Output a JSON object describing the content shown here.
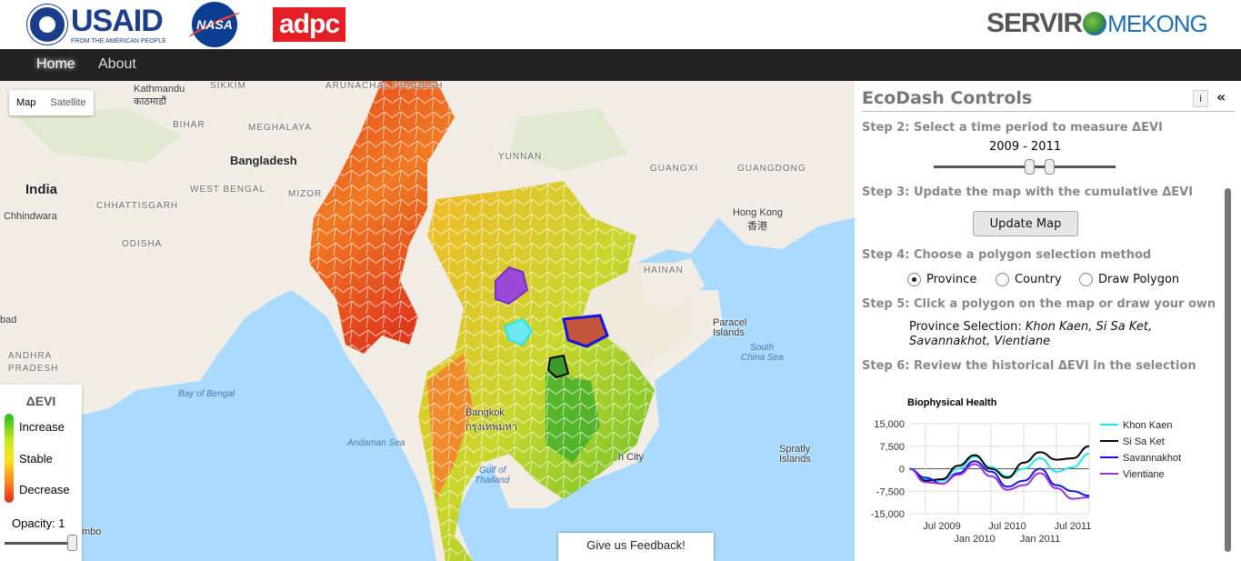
{
  "logos": {
    "usaid": {
      "word": "USAID",
      "sub": "FROM THE AMERICAN PEOPLE"
    },
    "nasa": "NASA",
    "adpc": "adpc",
    "servir_a": "SERVIR",
    "servir_b": "MEKONG"
  },
  "nav": {
    "home": "Home",
    "about": "About"
  },
  "map": {
    "type_buttons": [
      "Map",
      "Satellite"
    ],
    "labels": {
      "kathmandu": "Kathmandu",
      "kathmandu_local": "काठमाडौं",
      "sikkim": "SIKKIM",
      "arunachal": "ARUNACHAL PRADESH",
      "bihar": "BIHAR",
      "meghalaya": "MEGHALAYA",
      "bangladesh": "Bangladesh",
      "india": "India",
      "chhindwara": "Chhindwara",
      "west_bengal": "WEST BENGAL",
      "mizoram": "MIZOR",
      "chhattisgarh": "CHHATTISGARH",
      "odisha": "ODISHA",
      "andhra1": "ANDHRA",
      "andhra2": "PRADESH",
      "bad": "bad",
      "yunnan": "YUNNAN",
      "guangxi": "GUANGXI",
      "guangdong": "GUANGDONG",
      "hongkong": "Hong Kong",
      "hongkong_local": "香港",
      "hainan": "HAINAN",
      "paracel1": "Paracel",
      "paracel2": "Islands",
      "south_china1": "South",
      "south_china2": "China Sea",
      "bay_bengal": "Bay of Bengal",
      "andaman": "Andaman Sea",
      "gulf1": "Gulf of",
      "gulf2": "Thailand",
      "bangkok": "Bangkok",
      "bangkok_local": "กรุงเทพมหา",
      "city": "h City",
      "spratly1": "Spratly",
      "spratly2": "Islands",
      "mbo": "mbo"
    }
  },
  "legend": {
    "title": "ΔEVI",
    "increase": "Increase",
    "stable": "Stable",
    "decrease": "Decrease",
    "opacity": "Opacity: 1",
    "opacity_value": 1
  },
  "feedback": "Give us Feedback!",
  "panel": {
    "title": "EcoDash Controls",
    "info": "i",
    "collapse": "«",
    "step2": "Step 2: Select a time period to measure ΔEVI",
    "period": "2009 - 2011",
    "step3": "Step 3: Update the map with the cumulative ΔEVI",
    "update_button": "Update Map",
    "step4": "Step 4: Choose a polygon selection method",
    "radios": [
      "Province",
      "Country",
      "Draw Polygon"
    ],
    "selected_radio": "Province",
    "step5": "Step 5: Click a polygon on the map or draw your own",
    "selection_label": "Province Selection:",
    "selection_value": "Khon Kaen, Si Sa Ket, Savannakhot, Vientiane",
    "step6": "Step 6: Review the historical ΔEVI in the selection"
  },
  "chart_data": {
    "type": "line",
    "title": "Biophysical Health",
    "xlabel": "",
    "ylabel": "",
    "ylim": [
      -15000,
      15000
    ],
    "yticks": [
      "15,000",
      "7,500",
      "0",
      "-7,500",
      "-15,000"
    ],
    "xticks_top": [
      "Jul 2009",
      "Jul 2010",
      "Jul 2011"
    ],
    "xticks_bottom": [
      "Jan 2010",
      "Jan 2011"
    ],
    "x": [
      "2009-01",
      "2009-04",
      "2009-07",
      "2009-10",
      "2010-01",
      "2010-04",
      "2010-07",
      "2010-10",
      "2011-01",
      "2011-04",
      "2011-07",
      "2011-10"
    ],
    "legend_position": "right",
    "series": [
      {
        "name": "Khon Kaen",
        "color": "#1ee7f0",
        "values": [
          0,
          -3500,
          -4000,
          0,
          4000,
          500,
          -2500,
          0,
          3500,
          -1000,
          500,
          5000
        ]
      },
      {
        "name": "Si Sa Ket",
        "color": "#000000",
        "values": [
          0,
          -4000,
          -3500,
          1000,
          4500,
          0,
          -3000,
          2000,
          5500,
          3000,
          3500,
          7500
        ]
      },
      {
        "name": "Savannakhot",
        "color": "#1414e6",
        "values": [
          0,
          -3000,
          -5000,
          -1500,
          2500,
          -1000,
          -6000,
          -4000,
          0,
          -5500,
          -7500,
          -9000
        ]
      },
      {
        "name": "Vientiane",
        "color": "#9932e0",
        "values": [
          0,
          -4500,
          -5000,
          -2000,
          1500,
          -2500,
          -7000,
          -5500,
          -1500,
          -6500,
          -10000,
          -9500
        ]
      }
    ]
  }
}
